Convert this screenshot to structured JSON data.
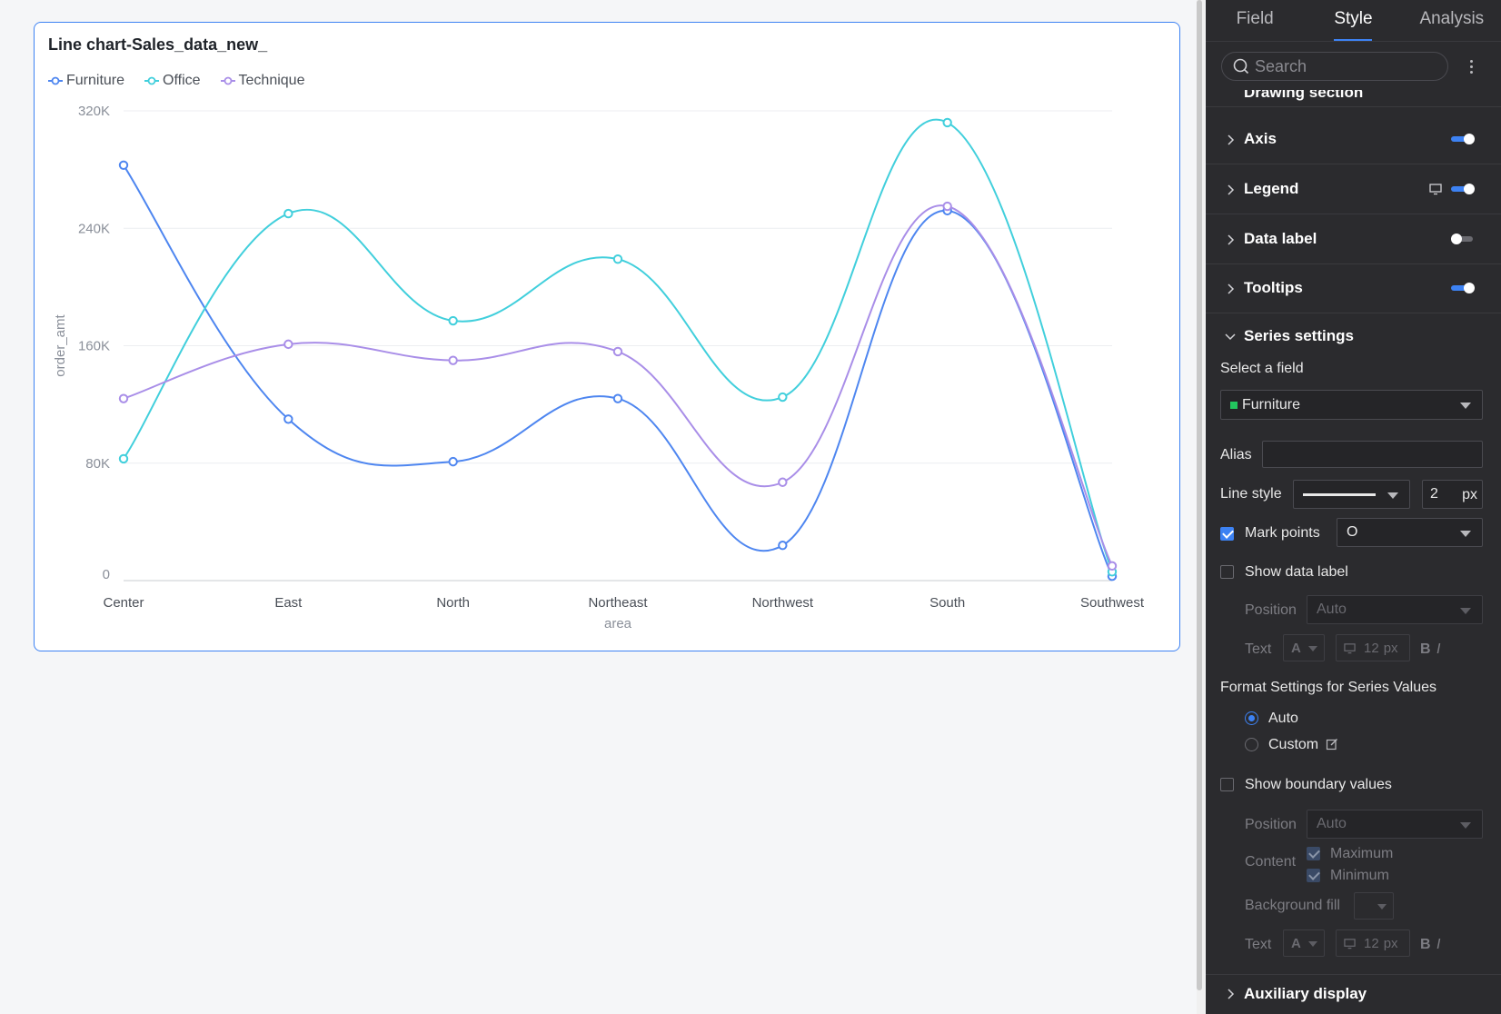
{
  "chart_title": "Line chart-Sales_data_new_",
  "chart_data": {
    "type": "line",
    "title": "Line chart-Sales_data_new_",
    "xlabel": "area",
    "ylabel": "order_amt",
    "categories": [
      "Center",
      "East",
      "North",
      "Northeast",
      "Northwest",
      "South",
      "Southwest"
    ],
    "y_ticks": [
      0,
      80000,
      160000,
      240000,
      320000
    ],
    "y_tick_labels": [
      "0",
      "80K",
      "160K",
      "240K",
      "320K"
    ],
    "ylim": [
      0,
      320000
    ],
    "smooth": true,
    "grid": true,
    "legend_position": "top-left",
    "series": [
      {
        "name": "Furniture",
        "color": "#4e86f0",
        "values": [
          283000,
          110000,
          81000,
          124000,
          24000,
          252000,
          3000
        ]
      },
      {
        "name": "Office",
        "color": "#41cfdc",
        "values": [
          83000,
          250000,
          177000,
          219000,
          125000,
          312000,
          6000
        ]
      },
      {
        "name": "Technique",
        "color": "#a98ee8",
        "values": [
          124000,
          161000,
          150000,
          156000,
          67000,
          255000,
          10000
        ]
      }
    ]
  },
  "panel": {
    "tabs": [
      "Field",
      "Style",
      "Analysis"
    ],
    "active_tab": "Style",
    "search_placeholder": "Search",
    "sections": {
      "drawing": "Drawing section",
      "axis": "Axis",
      "legend": "Legend",
      "data_label": "Data label",
      "tooltips": "Tooltips",
      "series_settings": "Series settings",
      "auxiliary": "Auxiliary display"
    },
    "toggles": {
      "axis": true,
      "legend": true,
      "data_label": false,
      "tooltips": true
    },
    "series": {
      "select_field_label": "Select a field",
      "selected_field": "Furniture",
      "selected_field_color": "#22c55e",
      "alias_label": "Alias",
      "alias_value": "",
      "line_style_label": "Line style",
      "line_width": "2",
      "unit_px": "px",
      "mark_points_label": "Mark points",
      "mark_points_checked": true,
      "mark_point_shape": "O",
      "show_data_label": "Show data label",
      "position_label": "Position",
      "position_value": "Auto",
      "text_label": "Text",
      "text_color_glyph": "A",
      "font_size": "12",
      "bold_glyph": "B",
      "italic_glyph": "I",
      "format_title": "Format Settings for Series Values",
      "format_auto": "Auto",
      "format_custom": "Custom",
      "show_boundary": "Show boundary values",
      "content_label": "Content",
      "maximum": "Maximum",
      "minimum": "Minimum",
      "background_fill": "Background fill"
    }
  }
}
